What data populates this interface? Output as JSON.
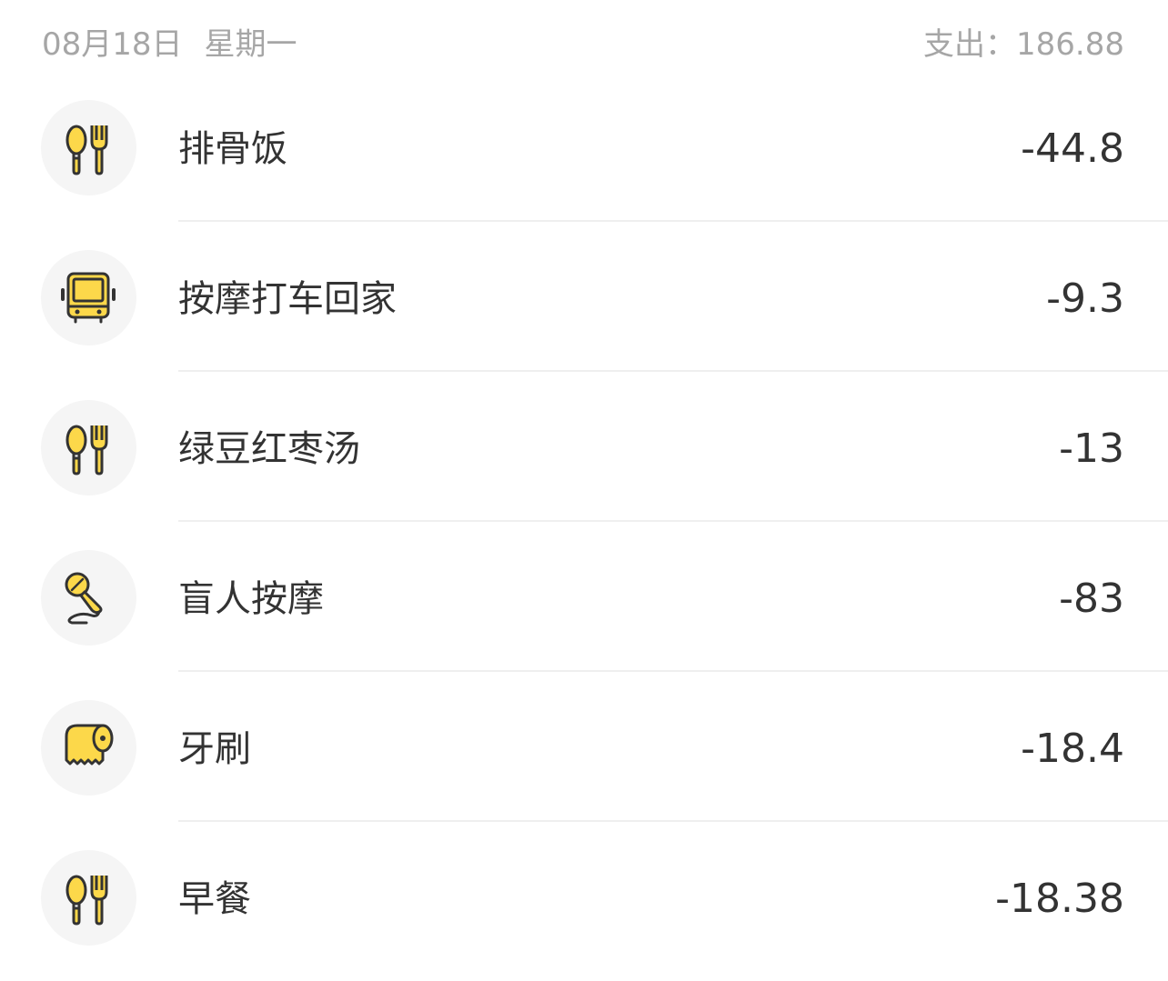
{
  "day": {
    "date": "08月18日",
    "weekday": "星期一",
    "total": "支出：186.88"
  },
  "colors": {
    "accent": "#fcd84a",
    "icon_outline": "#333333",
    "icon_bg": "#f5f5f5",
    "muted_text": "#a6a6a6",
    "divider": "#efefef"
  },
  "records": [
    {
      "icon": "utensils-icon",
      "title": "排骨饭",
      "amount": "-44.8"
    },
    {
      "icon": "bus-icon",
      "title": "按摩打车回家",
      "amount": "-9.3"
    },
    {
      "icon": "utensils-icon",
      "title": "绿豆红枣汤",
      "amount": "-13"
    },
    {
      "icon": "microphone-icon",
      "title": "盲人按摩",
      "amount": "-83"
    },
    {
      "icon": "toilet-paper-icon",
      "title": "牙刷",
      "amount": "-18.4"
    },
    {
      "icon": "utensils-icon",
      "title": "早餐",
      "amount": "-18.38"
    }
  ]
}
